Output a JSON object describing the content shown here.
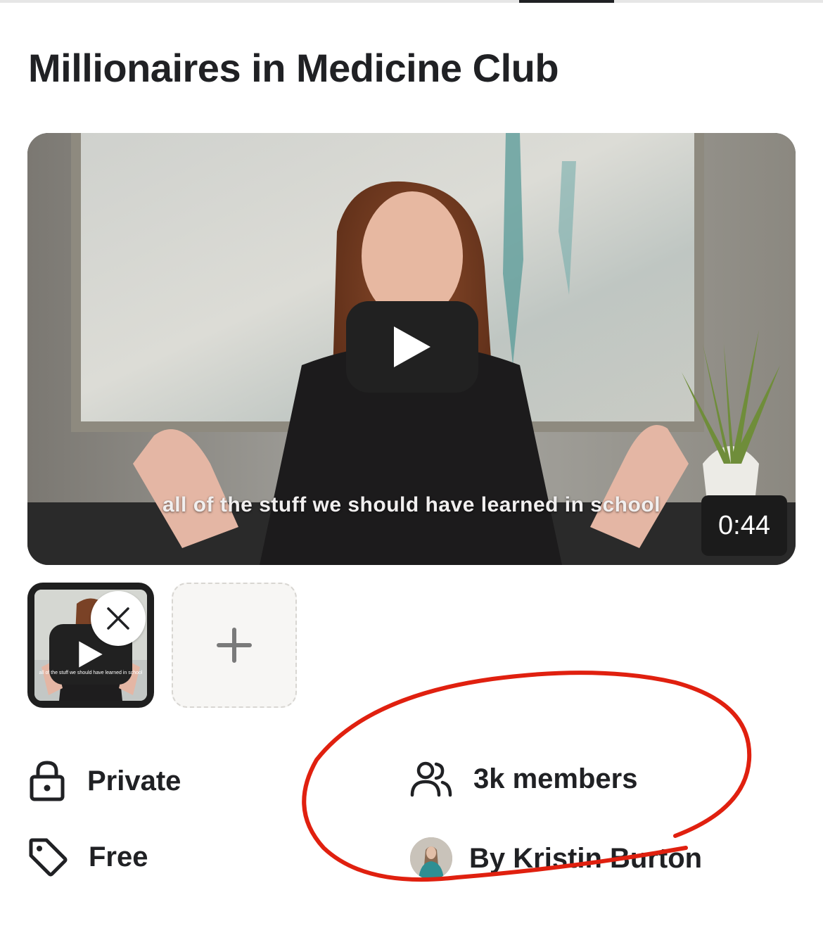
{
  "header": {
    "title": "Millionaires in Medicine Club"
  },
  "video": {
    "caption": "all of the stuff we should have learned in school",
    "duration": "0:44",
    "play_icon": "play-icon"
  },
  "media_strip": {
    "thumbnail_caption": "all of the stuff we should have learned in school",
    "remove_icon": "close-icon",
    "add_icon": "plus-icon"
  },
  "details": {
    "privacy": "Private",
    "members": "3k members",
    "price": "Free",
    "author": "By Kristin Burton"
  },
  "colors": {
    "text": "#202124",
    "annotation": "#e0200f",
    "player_button": "#212121"
  }
}
